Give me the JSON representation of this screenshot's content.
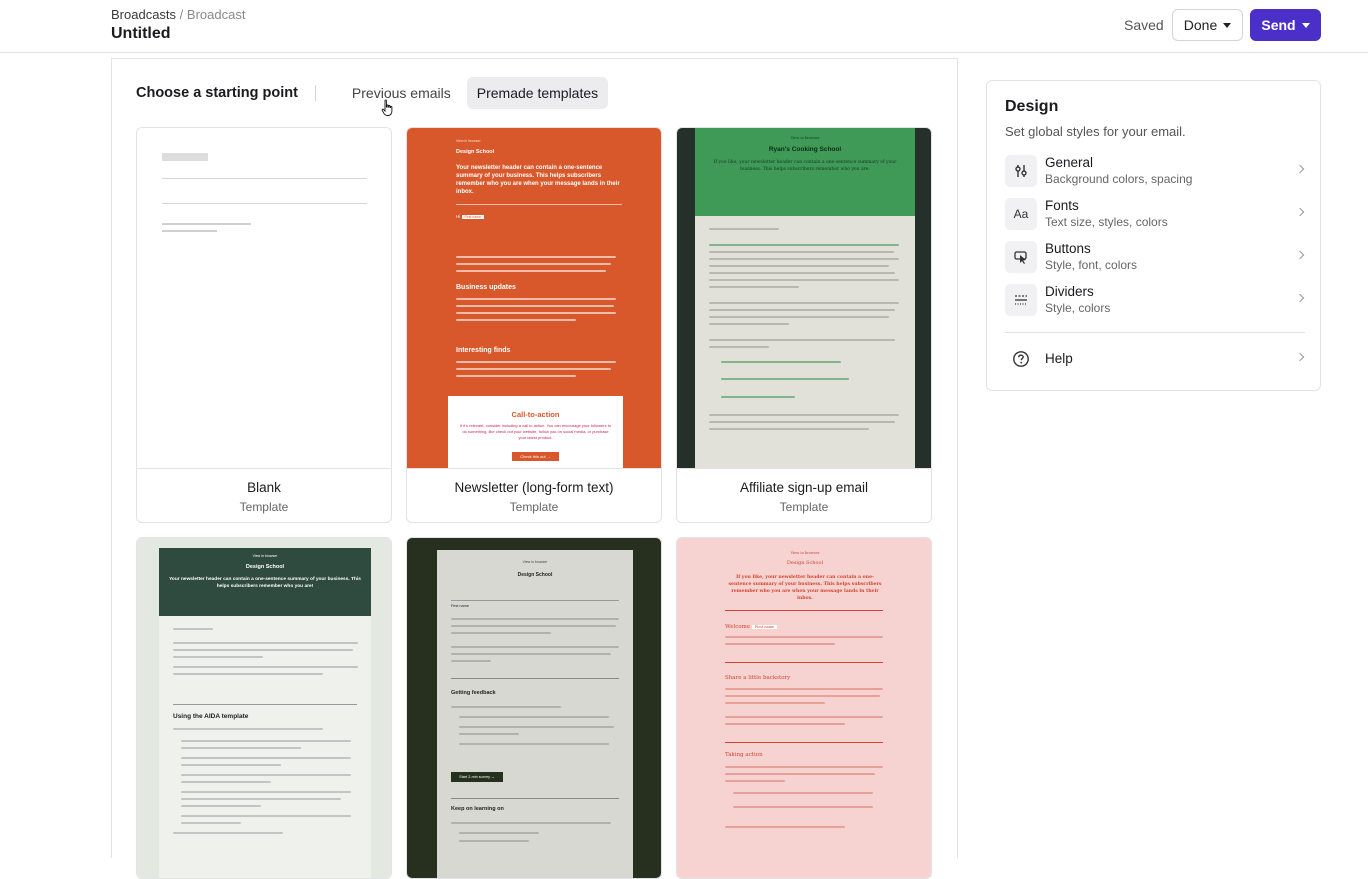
{
  "header": {
    "breadcrumb_parent": "Broadcasts",
    "breadcrumb_sep": "/",
    "breadcrumb_current": "Broadcast",
    "title": "Untitled",
    "saved_label": "Saved",
    "done_label": "Done",
    "send_label": "Send"
  },
  "start": {
    "heading": "Choose a starting point",
    "tabs": [
      {
        "label": "Previous emails",
        "active": false
      },
      {
        "label": "Premade templates",
        "active": true
      }
    ]
  },
  "templates": [
    {
      "name": "Blank",
      "sub": "Template"
    },
    {
      "name": "Newsletter (long-form text)",
      "sub": "Template"
    },
    {
      "name": "Affiliate sign-up email",
      "sub": "Template"
    }
  ],
  "thumbs": {
    "news": {
      "view": "View in browser",
      "brand": "Design School",
      "headline": "Your newsletter header can contain a one-sentence summary of your business. This helps subscribers remember who you are when your message lands in their inbox.",
      "hi": "Hi",
      "first_name": "First name",
      "s1": "Business updates",
      "s2": "Interesting finds",
      "cta": "Call-to-action",
      "cta_text": "If it's relevant, consider including a call to action. You can encourage your followers to do something, like check out your website, follow you on social media, or purchase your latest product.",
      "cta_btn": "Check this out →"
    },
    "aff": {
      "view": "View in browser",
      "brand": "Ryan's Cooking School",
      "intro": "If you like, your newsletter header can contain a one-sentence summary of your business. This helps subscribers remember who you are."
    },
    "aida": {
      "view": "View in browser",
      "brand": "Design School",
      "headline": "Your newsletter header can contain a one-sentence summary of your business. This helps subscribers remember who you are!",
      "section": "Using the AIDA template"
    },
    "fb": {
      "view": "View in browser",
      "brand": "Design School",
      "first_name": "First name",
      "s1": "Getting feedback",
      "btn": "Start 2-min survey →",
      "s2": "Keep on learning on"
    },
    "wel": {
      "view": "View in browser",
      "brand": "Design School",
      "headline": "If you like, your newsletter header can contain a one-sentence summary of your business. This helps subscribers remember who you are when your message lands in their inbox.",
      "welcome": "Welcome",
      "first_name": "First name",
      "s1": "Share a little backstory",
      "s2": "Taking action"
    }
  },
  "design": {
    "title": "Design",
    "subtitle": "Set global styles for your email.",
    "items": [
      {
        "name": "General",
        "desc": "Background colors, spacing",
        "icon": "sliders-icon"
      },
      {
        "name": "Fonts",
        "desc": "Text size, styles, colors",
        "icon": "fonts-icon"
      },
      {
        "name": "Buttons",
        "desc": "Style, font, colors",
        "icon": "button-cursor-icon"
      },
      {
        "name": "Dividers",
        "desc": "Style, colors",
        "icon": "dividers-icon"
      }
    ],
    "help": "Help"
  },
  "colors": {
    "accent": "#4b2fc9",
    "newsletter_bg": "#d9582b",
    "affiliate_header": "#3f9a57",
    "aida_header": "#2f4a3e",
    "welcome_bg": "#f6d2d0"
  }
}
